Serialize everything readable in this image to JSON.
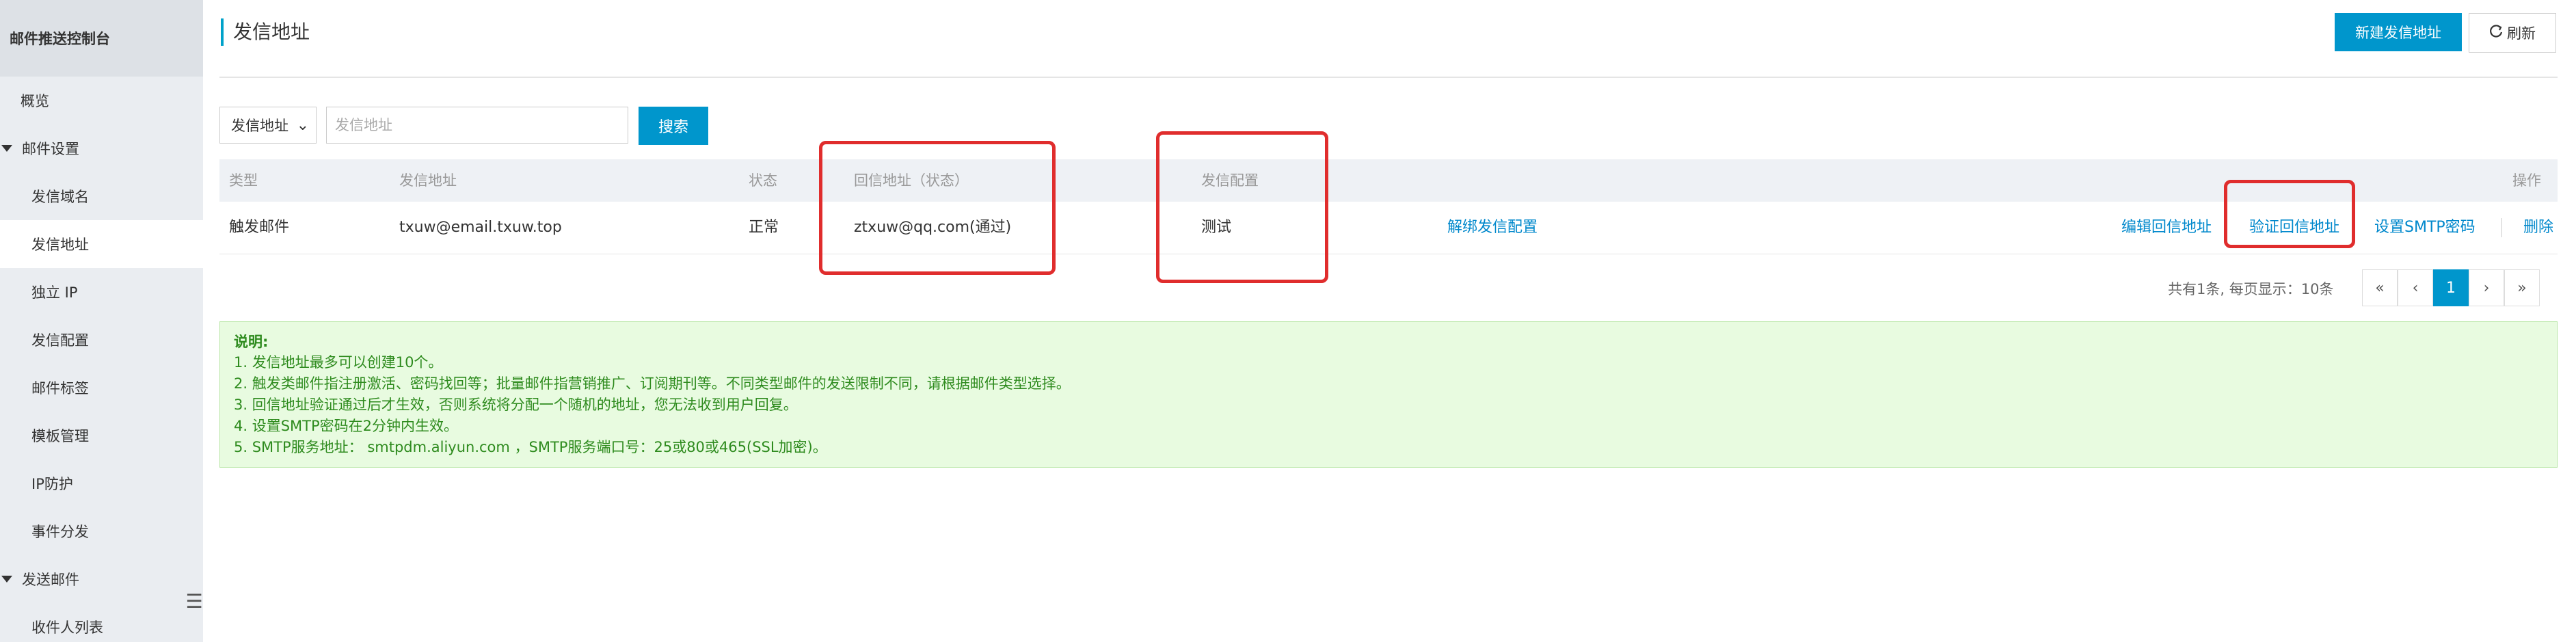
{
  "sidebar": {
    "title": "邮件推送控制台",
    "items": [
      {
        "label": "概览",
        "type": "top"
      },
      {
        "label": "邮件设置",
        "type": "group"
      },
      {
        "label": "发信域名",
        "type": "sub"
      },
      {
        "label": "发信地址",
        "type": "sub",
        "active": true
      },
      {
        "label": "独立 IP",
        "type": "sub"
      },
      {
        "label": "发信配置",
        "type": "sub"
      },
      {
        "label": "邮件标签",
        "type": "sub"
      },
      {
        "label": "模板管理",
        "type": "sub"
      },
      {
        "label": "IP防护",
        "type": "sub"
      },
      {
        "label": "事件分发",
        "type": "sub"
      },
      {
        "label": "发送邮件",
        "type": "group"
      },
      {
        "label": "收件人列表",
        "type": "sub"
      }
    ],
    "collapse_icon": "list-collapse-icon"
  },
  "header": {
    "title": "发信地址",
    "new_button": "新建发信地址",
    "refresh_button": "刷新",
    "refresh_icon": "refresh-icon"
  },
  "search": {
    "select_value": "发信地址",
    "placeholder": "发信地址",
    "button": "搜索"
  },
  "table": {
    "columns": [
      "类型",
      "发信地址",
      "状态",
      "回信地址（状态）",
      "发信配置",
      "操作"
    ],
    "rows": [
      {
        "type": "触发邮件",
        "address": "txuw@email.txuw.top",
        "status": "正常",
        "reply": "ztxuw@qq.com(通过)",
        "config": "测试",
        "unbind": "解绑发信配置",
        "actions": [
          "编辑回信地址",
          "验证回信地址",
          "设置SMTP密码",
          "删除"
        ]
      }
    ]
  },
  "pagination": {
    "info": "共有1条, 每页显示：10条",
    "first": "«",
    "prev": "‹",
    "current": "1",
    "next": "›",
    "last": "»"
  },
  "notice": {
    "title": "说明:",
    "lines": [
      "1. 发信地址最多可以创建10个。",
      "2. 触发类邮件指注册激活、密码找回等；批量邮件指营销推广、订阅期刊等。不同类型邮件的发送限制不同，请根据邮件类型选择。",
      "3. 回信地址验证通过后才生效，否则系统将分配一个随机的地址，您无法收到用户回复。",
      "4. 设置SMTP密码在2分钟内生效。",
      "5. SMTP服务地址： smtpdm.aliyun.com ，SMTP服务端口号：25或80或465(SSL加密)。"
    ]
  },
  "colors": {
    "primary": "#0096cc",
    "annotation": "#e02d2d",
    "notice_text": "#2e8b1e",
    "notice_bg": "#e8fbe0"
  }
}
